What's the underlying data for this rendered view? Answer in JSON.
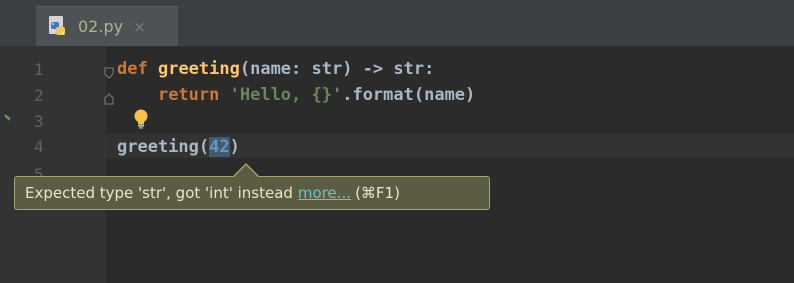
{
  "editor": {
    "tab": {
      "filename": "02.py",
      "close_glyph": "×",
      "icon": "python-file-icon"
    },
    "line_numbers": [
      "1",
      "2",
      "3",
      "4",
      "5"
    ],
    "code": {
      "line1": {
        "kw": "def",
        "fn": "greeting",
        "rest": "(name: str) -> str:"
      },
      "line2": {
        "indent": "    ",
        "kw": "return",
        "str": "'Hello, {}'",
        "rest": ".format(name)"
      },
      "line4": {
        "call": "greeting(",
        "arg": "42",
        "close": ")"
      }
    },
    "intention_icon": "lightbulb-icon",
    "status_icon": "checkmark-icon"
  },
  "tooltip": {
    "message": "Expected type 'str', got 'int' instead",
    "more_link": "more...",
    "shortcut": "(⌘F1)"
  },
  "colors": {
    "background": "#2b2b2b",
    "keyword": "#cc7832",
    "function": "#ffc66d",
    "string": "#6a8759",
    "number": "#6897bb",
    "tooltip_bg": "#5c5c42",
    "tooltip_border": "#a3a36a"
  }
}
